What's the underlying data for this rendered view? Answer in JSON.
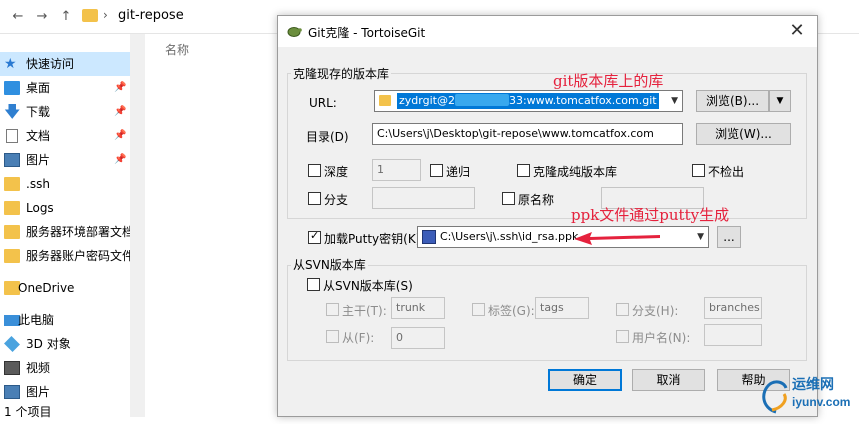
{
  "explorer": {
    "path": "git-repose",
    "column_name": "名称",
    "sidebar": [
      {
        "label": "快速访问",
        "icon": "star-icon"
      },
      {
        "label": "桌面",
        "icon": "desktop-icon",
        "pinned": true
      },
      {
        "label": "下载",
        "icon": "download-icon",
        "pinned": true
      },
      {
        "label": "文档",
        "icon": "document-icon",
        "pinned": true
      },
      {
        "label": "图片",
        "icon": "picture-icon",
        "pinned": true
      },
      {
        "label": ".ssh",
        "icon": "folder-icon"
      },
      {
        "label": "Logs",
        "icon": "folder-icon"
      },
      {
        "label": "服务器环境部署文档",
        "icon": "folder-icon"
      },
      {
        "label": "服务器账户密码文件",
        "icon": "folder-icon"
      },
      {
        "label": "OneDrive",
        "icon": "cloud-icon"
      },
      {
        "label": "此电脑",
        "icon": "computer-icon"
      },
      {
        "label": "3D 对象",
        "icon": "cube-icon"
      },
      {
        "label": "视频",
        "icon": "video-icon"
      },
      {
        "label": "图片",
        "icon": "picture-icon"
      },
      {
        "label": "1 个项目",
        "icon": ""
      }
    ]
  },
  "dialog": {
    "title": "Git克隆 - TortoiseGit",
    "clone_group_title": "克隆现存的版本库",
    "url_label": "URL:",
    "url_value": "zydrgit@2███████33:www.tomcatfox.com.git",
    "url_prefix": "zydrgit@2",
    "url_suffix": "33:www.tomcatfox.com.git",
    "browse_url_label": "浏览(B)...",
    "dir_label": "目录(D)",
    "dir_value": "C:\\Users\\j\\Desktop\\git-repose\\www.tomcatfox.com",
    "browse_dir_label": "浏览(W)...",
    "depth_label": "深度",
    "depth_value": "1",
    "recursive_label": "递归",
    "bare_label": "克隆成纯版本库",
    "no_checkout_label": "不检出",
    "branch_label": "分支",
    "origin_label": "原名称",
    "putty_label": "加载Putty密钥(K)",
    "putty_value": "C:\\Users\\j\\.ssh\\id_rsa.ppk",
    "putty_browse": "...",
    "svn_group_title": "从SVN版本库",
    "from_svn_label": "从SVN版本库(S)",
    "trunk_label": "主干(T):",
    "trunk_value": "trunk",
    "tags_label": "标签(G):",
    "tags_value": "tags",
    "branches_label": "分支(H):",
    "branches_value": "branches",
    "from_label": "从(F):",
    "from_value": "0",
    "username_label": "用户名(N):",
    "ok_label": "确定",
    "cancel_label": "取消",
    "help_label": "帮助"
  },
  "annotations": {
    "repo_note": "git版本库上的库",
    "ppk_note": "ppk文件通过putty生成",
    "arrow_color": "#e5223d"
  },
  "watermark": {
    "cn": "运维网",
    "url": "iyunv.com"
  }
}
